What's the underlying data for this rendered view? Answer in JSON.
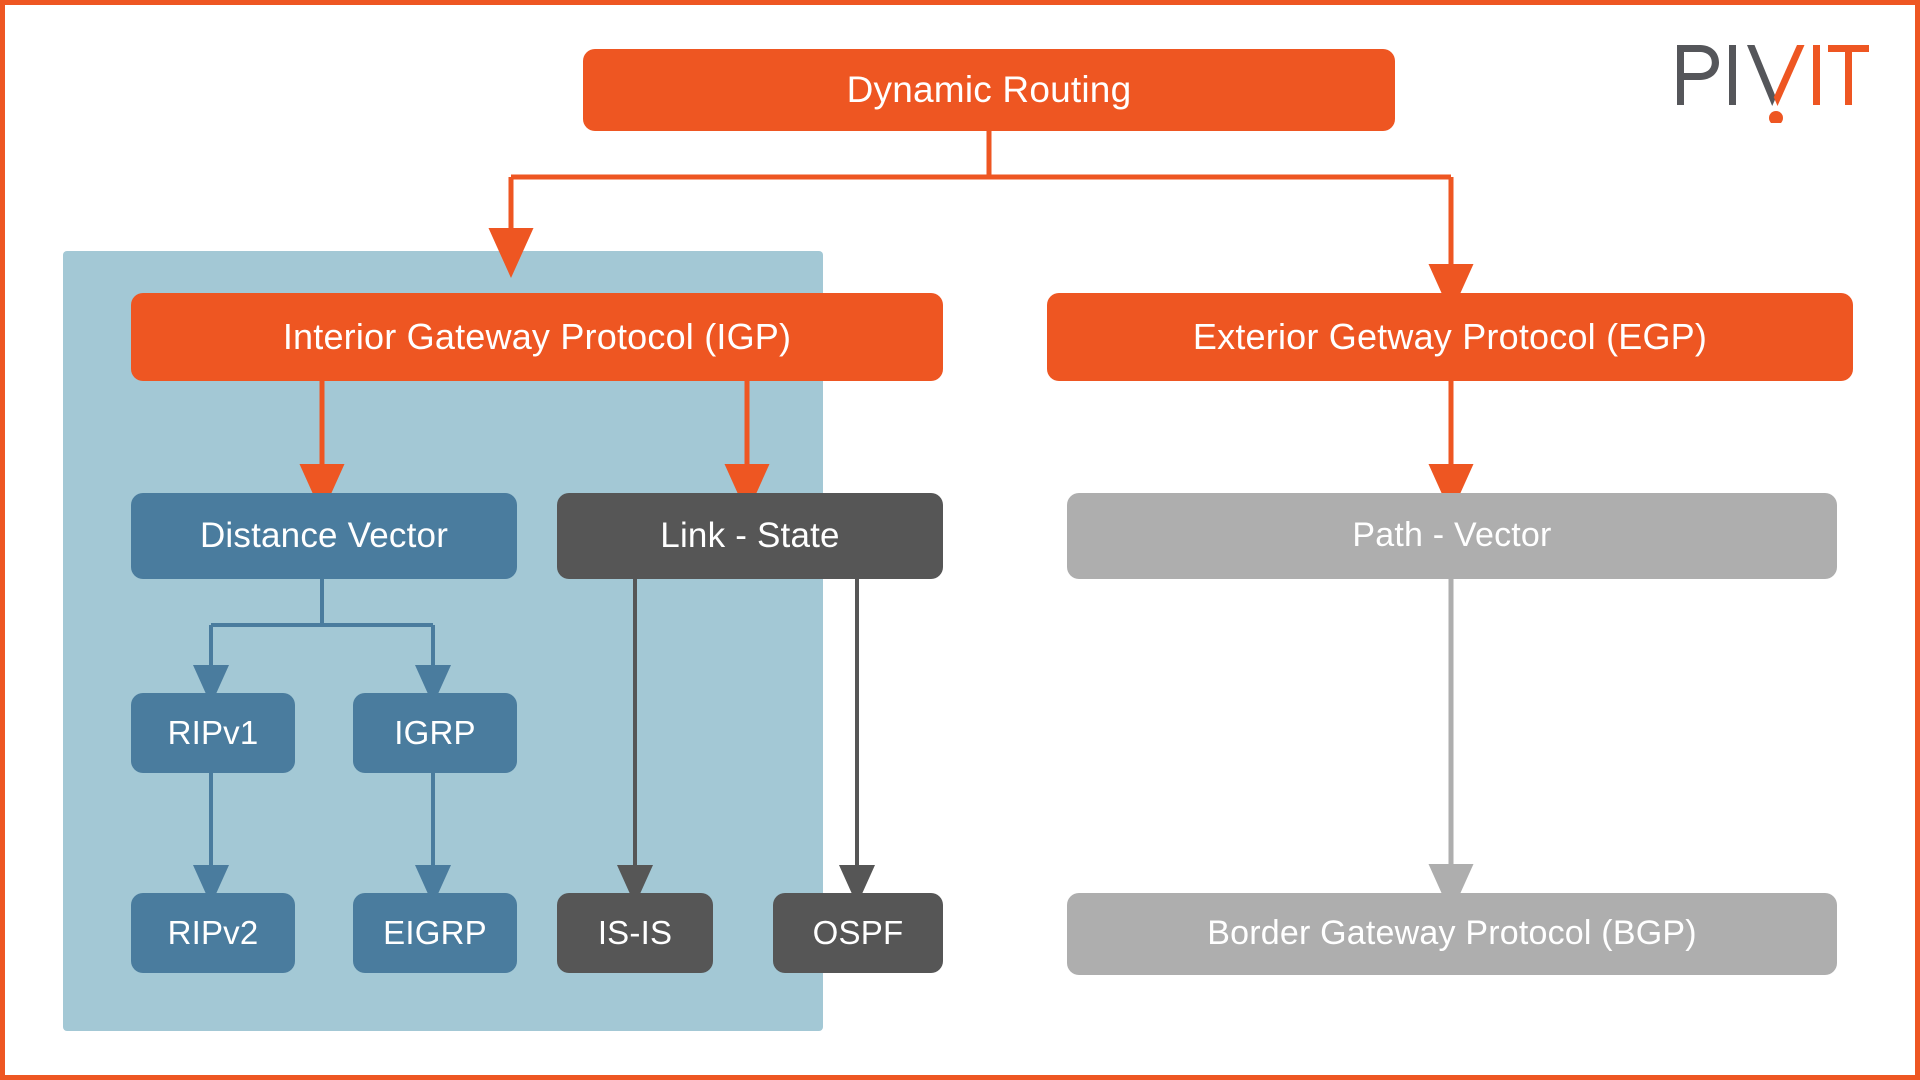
{
  "branding": {
    "logo_name": "pivit-logo",
    "logo_text_dark": "PIV",
    "logo_text_accent": "IT",
    "logo_accent_color": "#ee5622",
    "logo_dark_color": "#55565a"
  },
  "palette": {
    "orange": "#ee5622",
    "panel_blue": "#a3c8d5",
    "steel_blue": "#4a7c9e",
    "dark_gray": "#565656",
    "mid_gray": "#aeaeae",
    "white": "#ffffff",
    "border": "#ee5622"
  },
  "diagram": {
    "title": "Dynamic Routing",
    "root": {
      "label": "Dynamic Routing",
      "color": "orange"
    },
    "igp_panel_label": "interior-gateway-protocol-group",
    "nodes": [
      {
        "id": "dynamic-routing",
        "label": "Dynamic Routing",
        "color": "orange"
      },
      {
        "id": "igp",
        "label": "Interior Gateway Protocol (IGP)",
        "color": "orange"
      },
      {
        "id": "egp",
        "label": "Exterior Getway Protocol (EGP)",
        "color": "orange"
      },
      {
        "id": "distance-vector",
        "label": "Distance Vector",
        "color": "steel_blue"
      },
      {
        "id": "link-state",
        "label": "Link - State",
        "color": "dark_gray"
      },
      {
        "id": "path-vector",
        "label": "Path - Vector",
        "color": "mid_gray"
      },
      {
        "id": "ripv1",
        "label": "RIPv1",
        "color": "steel_blue"
      },
      {
        "id": "igrp",
        "label": "IGRP",
        "color": "steel_blue"
      },
      {
        "id": "ripv2",
        "label": "RIPv2",
        "color": "steel_blue"
      },
      {
        "id": "eigrp",
        "label": "EIGRP",
        "color": "steel_blue"
      },
      {
        "id": "is-is",
        "label": "IS-IS",
        "color": "dark_gray"
      },
      {
        "id": "ospf",
        "label": "OSPF",
        "color": "dark_gray"
      },
      {
        "id": "bgp",
        "label": "Border Gateway Protocol (BGP)",
        "color": "mid_gray"
      }
    ],
    "edges": [
      {
        "from": "dynamic-routing",
        "to": "igp",
        "color": "orange"
      },
      {
        "from": "dynamic-routing",
        "to": "egp",
        "color": "orange"
      },
      {
        "from": "igp",
        "to": "distance-vector",
        "color": "orange"
      },
      {
        "from": "igp",
        "to": "link-state",
        "color": "orange"
      },
      {
        "from": "egp",
        "to": "path-vector",
        "color": "orange"
      },
      {
        "from": "distance-vector",
        "to": "ripv1",
        "color": "steel_blue"
      },
      {
        "from": "distance-vector",
        "to": "igrp",
        "color": "steel_blue"
      },
      {
        "from": "ripv1",
        "to": "ripv2",
        "color": "steel_blue"
      },
      {
        "from": "igrp",
        "to": "eigrp",
        "color": "steel_blue"
      },
      {
        "from": "link-state",
        "to": "is-is",
        "color": "dark_gray"
      },
      {
        "from": "link-state",
        "to": "ospf",
        "color": "dark_gray"
      },
      {
        "from": "path-vector",
        "to": "bgp",
        "color": "mid_gray"
      }
    ]
  }
}
